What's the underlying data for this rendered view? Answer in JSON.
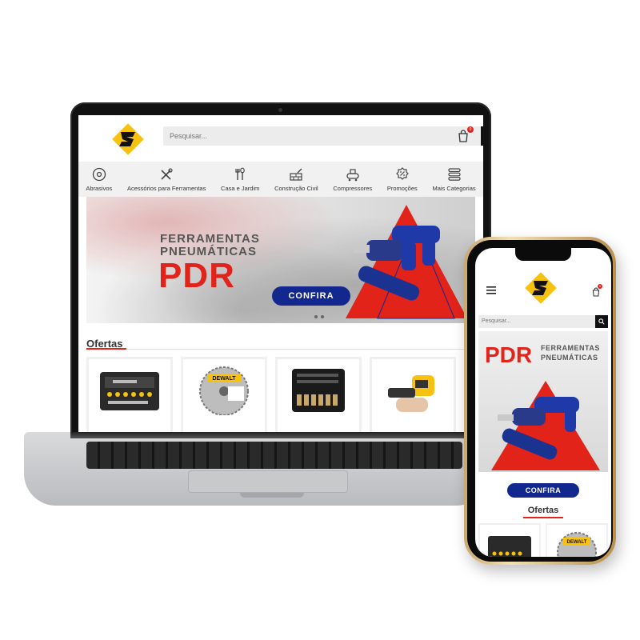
{
  "desktop": {
    "search": {
      "placeholder": "Pesquisar..."
    },
    "cart": {
      "count": "0"
    },
    "nav": {
      "items": [
        {
          "label": "Abrasivos",
          "icon": "disc-icon"
        },
        {
          "label": "Acessórios para Ferramentas",
          "icon": "tools-icon"
        },
        {
          "label": "Casa e Jardim",
          "icon": "garden-tools-icon"
        },
        {
          "label": "Construção Civil",
          "icon": "brick-wall-icon"
        },
        {
          "label": "Compressores",
          "icon": "compressor-icon"
        },
        {
          "label": "Promoções",
          "icon": "discount-badge-icon"
        },
        {
          "label": "Mais Categorias",
          "icon": "stack-menu-icon"
        }
      ]
    },
    "banner": {
      "line1": "FERRAMENTAS",
      "line2": "PNEUMÁTICAS",
      "headline": "PDR",
      "cta": "CONFIRA"
    },
    "section": {
      "title": "Ofertas"
    },
    "products": [
      {
        "name": "socket-set-case",
        "icon": "socket-case-icon"
      },
      {
        "name": "dewalt-saw-blade",
        "brand": "DEWALT",
        "icon": "saw-blade-icon"
      },
      {
        "name": "socket-kit",
        "icon": "socket-kit-icon"
      },
      {
        "name": "yellow-tool",
        "icon": "power-tool-icon"
      }
    ]
  },
  "mobile": {
    "search": {
      "placeholder": "Pesquisar..."
    },
    "cart": {
      "count": "0"
    },
    "banner": {
      "headline": "PDR",
      "line1": "FERRAMENTAS",
      "line2": "PNEUMÁTICAS"
    },
    "cta": "CONFIRA",
    "section": {
      "title": "Ofertas"
    },
    "products": [
      {
        "name": "socket-set-case"
      },
      {
        "name": "dewalt-saw-blade",
        "brand": "DEWALT"
      }
    ]
  },
  "colors": {
    "brand_yellow": "#f6c20f",
    "accent_red": "#e2231a",
    "cta_blue": "#12288f",
    "tool_blue": "#1f3aa8",
    "dark": "#111111"
  }
}
